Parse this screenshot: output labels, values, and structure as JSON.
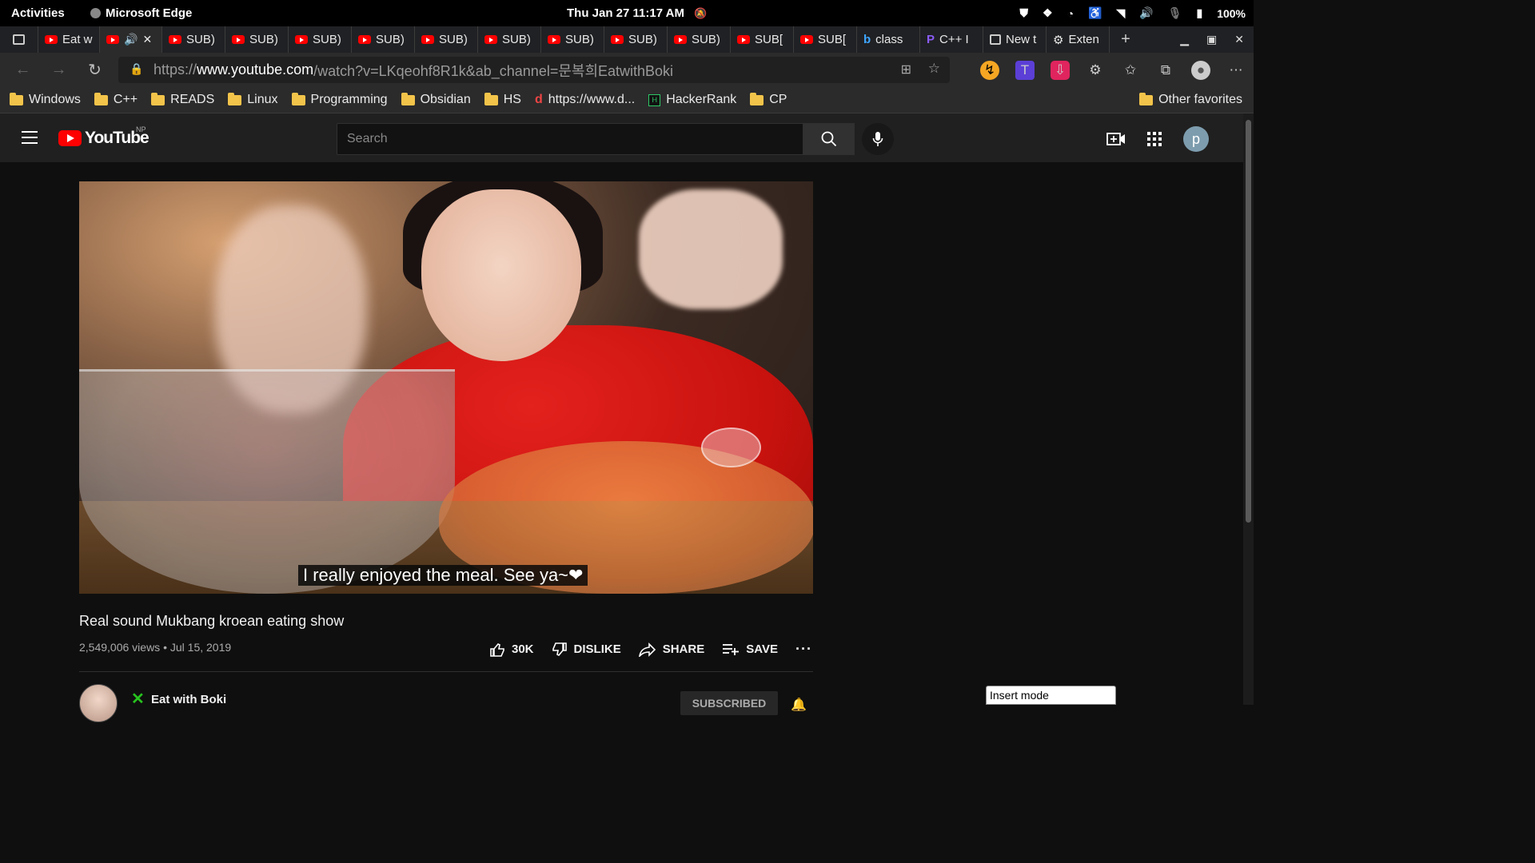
{
  "system": {
    "activities": "Activities",
    "app_name": "Microsoft Edge",
    "datetime": "Thu Jan 27  11:17 AM",
    "battery": "100%"
  },
  "tabs": [
    {
      "label": "Eat w",
      "icon": "youtube-icon"
    },
    {
      "label": "",
      "icon": "youtube-icon",
      "active": true
    },
    {
      "label": "SUB)",
      "icon": "youtube-icon"
    },
    {
      "label": "SUB)",
      "icon": "youtube-icon"
    },
    {
      "label": "SUB)",
      "icon": "youtube-icon"
    },
    {
      "label": "SUB)",
      "icon": "youtube-icon"
    },
    {
      "label": "SUB)",
      "icon": "youtube-icon"
    },
    {
      "label": "SUB)",
      "icon": "youtube-icon"
    },
    {
      "label": "SUB)",
      "icon": "youtube-icon"
    },
    {
      "label": "SUB)",
      "icon": "youtube-icon"
    },
    {
      "label": "SUB)",
      "icon": "youtube-icon"
    },
    {
      "label": "SUB[",
      "icon": "youtube-icon"
    },
    {
      "label": "SUB[",
      "icon": "youtube-icon"
    },
    {
      "label": "class",
      "icon": "bing-icon"
    },
    {
      "label": "C++ I",
      "icon": "app-icon"
    },
    {
      "label": "New t",
      "icon": "newtab-icon"
    },
    {
      "label": "Exten",
      "icon": "extensions-icon"
    }
  ],
  "address": {
    "url_prefix": "https://",
    "url_host": "www.youtube.com",
    "url_path": "/watch?v=LKqeohf8R1k&ab_channel=문복희EatwithBoki"
  },
  "favorites": [
    {
      "label": "Windows",
      "icon": "folder-icon"
    },
    {
      "label": "C++",
      "icon": "folder-icon"
    },
    {
      "label": "READS",
      "icon": "folder-icon"
    },
    {
      "label": "Linux",
      "icon": "folder-icon"
    },
    {
      "label": "Programming",
      "icon": "folder-icon"
    },
    {
      "label": "Obsidian",
      "icon": "folder-icon"
    },
    {
      "label": "HS",
      "icon": "folder-icon"
    },
    {
      "label": "https://www.d...",
      "icon": "link-icon"
    },
    {
      "label": "HackerRank",
      "icon": "hackerrank-icon"
    },
    {
      "label": "CP",
      "icon": "folder-icon"
    }
  ],
  "favorites_other": "Other favorites",
  "youtube": {
    "logo_text": "YouTube",
    "region": "NP",
    "search_placeholder": "Search",
    "avatar_letter": "p"
  },
  "video": {
    "caption": "I really enjoyed the meal. See ya~❤",
    "title": "Real sound Mukbang kroean eating show",
    "views": "2,549,006 views",
    "date": "Jul 15, 2019",
    "likes": "30K",
    "dislike_label": "DISLIKE",
    "share_label": "SHARE",
    "save_label": "SAVE",
    "more_label": "···"
  },
  "channel": {
    "name": "Eat with Boki",
    "subscribe_label": "SUBSCRIBED"
  },
  "status": {
    "insert_mode": "Insert mode"
  }
}
